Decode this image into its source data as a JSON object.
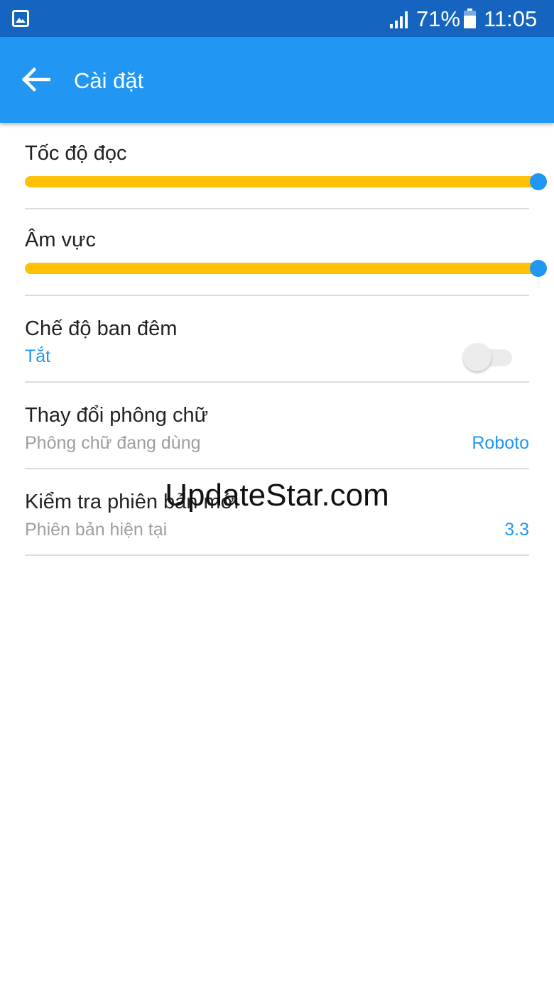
{
  "status_bar": {
    "battery": "71%",
    "time": "11:05",
    "icons": [
      "gallery-icon",
      "signal-icon",
      "battery-icon"
    ]
  },
  "app_bar": {
    "title": "Cài đặt",
    "back_icon": "arrow-left-icon"
  },
  "settings": {
    "reading_speed": {
      "label": "Tốc độ đọc",
      "value_fraction": 1.0
    },
    "volume": {
      "label": "Âm vực",
      "value_fraction": 1.0
    },
    "night_mode": {
      "label": "Chế độ ban đêm",
      "status": "Tắt",
      "enabled": false
    },
    "font": {
      "label": "Thay đổi phông chữ",
      "sublabel": "Phông chữ đang dùng",
      "value": "Roboto"
    },
    "version": {
      "label": "Kiểm tra phiên bản mới",
      "sublabel": "Phiên bản hiện tại",
      "value": "3.3"
    }
  },
  "watermark": "UpdateStar.com",
  "colors": {
    "status_bar": "#1565c0",
    "app_bar": "#2196f3",
    "accent": "#2196f3",
    "slider_track": "#ffc107"
  }
}
